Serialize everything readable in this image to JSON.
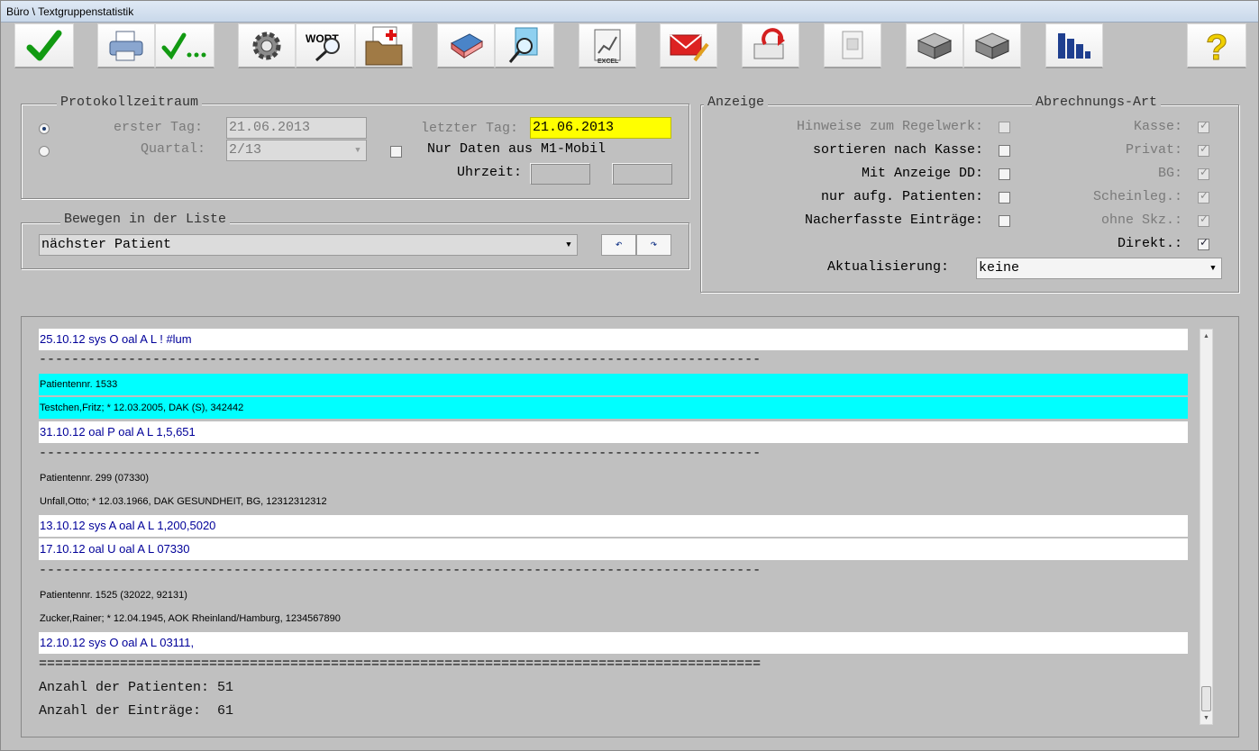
{
  "window": {
    "title": "Büro \\ Textgruppenstatistik"
  },
  "toolbar": {
    "buttons": [
      {
        "icon": "check-icon"
      },
      {
        "icon": "printer-icon"
      },
      {
        "icon": "check-dots-icon"
      },
      {
        "icon": "gear-icon"
      },
      {
        "icon": "word-search-icon",
        "text": "WORT"
      },
      {
        "icon": "medical-folder-icon"
      },
      {
        "icon": "eraser-icon"
      },
      {
        "icon": "document-search-icon"
      },
      {
        "icon": "excel-chart-icon",
        "text": "EXCEL"
      },
      {
        "icon": "mail-pen-icon"
      },
      {
        "icon": "undo-arrow-icon"
      },
      {
        "icon": "notepad-icon"
      },
      {
        "icon": "stack-icon"
      },
      {
        "icon": "stack-icon"
      },
      {
        "icon": "bar-chart-icon"
      },
      {
        "icon": "help-icon",
        "text": "?"
      }
    ]
  },
  "protokoll": {
    "legend": "Protokollzeitraum",
    "erster_tag_label": "erster Tag:",
    "erster_tag_value": "21.06.2013",
    "quartal_label": "Quartal:",
    "quartal_value": "2/13",
    "letzter_tag_label": "letzter Tag:",
    "letzter_tag_value": "21.06.2013",
    "m1_label": "Nur Daten aus M1-Mobil",
    "uhrzeit_label": "Uhrzeit:",
    "uhrzeit_from": "",
    "uhrzeit_to": ""
  },
  "bewegen": {
    "legend": "Bewegen in der Liste",
    "select_value": "nächster Patient"
  },
  "anzeige": {
    "legend": "Anzeige",
    "abrechnung_legend": "Abrechnungs-Art",
    "left_options": [
      {
        "label": "Hinweise zum Regelwerk:",
        "checked": false,
        "enabled": false
      },
      {
        "label": "sortieren nach Kasse:",
        "checked": false,
        "enabled": true
      },
      {
        "label": "Mit Anzeige DD:",
        "checked": false,
        "enabled": true
      },
      {
        "label": "nur aufg. Patienten:",
        "checked": false,
        "enabled": true
      },
      {
        "label": "Nacherfasste Einträge:",
        "checked": false,
        "enabled": true
      }
    ],
    "right_options": [
      {
        "label": "Kasse:",
        "checked": true,
        "enabled": false
      },
      {
        "label": "Privat:",
        "checked": true,
        "enabled": false
      },
      {
        "label": "BG:",
        "checked": true,
        "enabled": false
      },
      {
        "label": "Scheinleg.:",
        "checked": true,
        "enabled": false
      },
      {
        "label": "ohne Skz.:",
        "checked": true,
        "enabled": false
      },
      {
        "label": "Direkt.:",
        "checked": true,
        "enabled": true
      }
    ],
    "aktualisierung_label": "Aktualisierung:",
    "aktualisierung_value": "keine"
  },
  "list": {
    "rows": [
      {
        "kind": "entry",
        "text": "25.10.12 sys O oal A  L ! #lum"
      },
      {
        "kind": "sep",
        "text": "-----------------------------------------------------------------------------------------"
      },
      {
        "kind": "pat-hl",
        "text": "Patientennr. 1533"
      },
      {
        "kind": "pat-hl",
        "text": " Testchen,Fritz; * 12.03.2005, DAK (S), 342442"
      },
      {
        "kind": "entry",
        "text": "31.10.12 oal P oal A  L  1,5,651"
      },
      {
        "kind": "sep",
        "text": "-----------------------------------------------------------------------------------------"
      },
      {
        "kind": "pat",
        "text": "Patientennr. 299 (07330)"
      },
      {
        "kind": "pat",
        "text": " Unfall,Otto; * 12.03.1966, DAK GESUNDHEIT, BG, 12312312312"
      },
      {
        "kind": "entry",
        "text": "13.10.12 sys A oal A  L  1,200,5020"
      },
      {
        "kind": "entry",
        "text": "17.10.12 oal U oal A  L  07330"
      },
      {
        "kind": "sep",
        "text": "-----------------------------------------------------------------------------------------"
      },
      {
        "kind": "pat",
        "text": "Patientennr. 1525 (32022, 92131)"
      },
      {
        "kind": "pat",
        "text": " Zucker,Rainer; * 12.04.1945, AOK Rheinland/Hamburg, 1234567890"
      },
      {
        "kind": "entry",
        "text": "12.10.12 sys O oal A  L  03111,"
      },
      {
        "kind": "sep",
        "text": "========================================================================================="
      },
      {
        "kind": "sum",
        "text": "Anzahl der Patienten: 51"
      },
      {
        "kind": "sum",
        "text": "Anzahl der Einträge:  61"
      }
    ]
  }
}
